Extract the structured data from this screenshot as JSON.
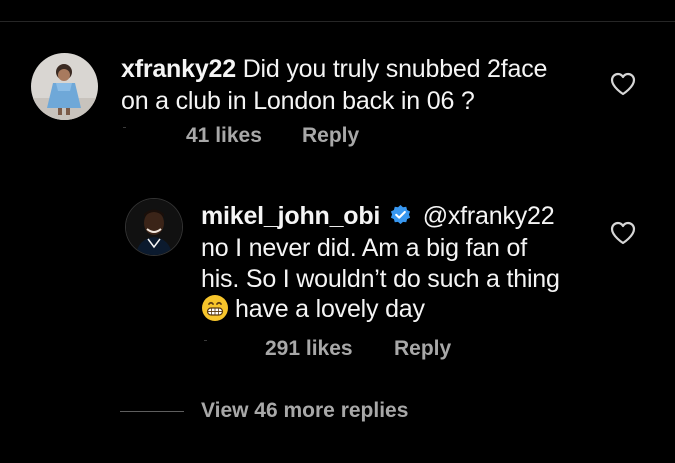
{
  "comment1": {
    "username": "xfranky22",
    "text_line1": "Did you truly snubbed 2face",
    "text_line2": "on a club in London back in 06 ?",
    "likes": "41 likes",
    "reply": "Reply",
    "avatar_icon": "child-photo-avatar",
    "like_icon": "heart-outline-icon"
  },
  "comment2": {
    "username": "mikel_john_obi",
    "verified_icon": "verified-badge-icon",
    "mention": "@xfranky22",
    "text_line2": "no I never did. Am a big fan of",
    "text_line3": "his. So I wouldn’t do such a thing",
    "emoji_icon": "grinning-emoji-icon",
    "text_line4": "have a lovely day",
    "likes": "291 likes",
    "reply": "Reply",
    "avatar_icon": "man-photo-avatar",
    "like_icon": "heart-outline-icon"
  },
  "view_more": "View 46 more replies",
  "colors": {
    "background": "#000000",
    "text": "#f5f5f5",
    "muted": "#a8a8a8",
    "verified": "#3897f0"
  }
}
